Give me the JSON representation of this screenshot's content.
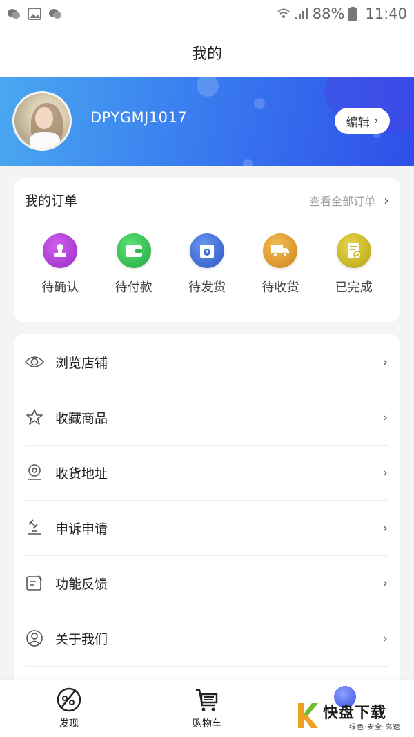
{
  "status_bar": {
    "battery_percent": "88%",
    "time": "11:40"
  },
  "header": {
    "title": "我的"
  },
  "profile": {
    "username": "DPYGMJ1017",
    "edit_label": "编辑"
  },
  "orders": {
    "title": "我的订单",
    "view_all": "查看全部订单",
    "items": [
      {
        "label": "待确认",
        "icon": "stamp-icon",
        "color": "#b23ad6"
      },
      {
        "label": "待付款",
        "icon": "wallet-icon",
        "color": "#2fbf4c"
      },
      {
        "label": "待发货",
        "icon": "package-clock-icon",
        "color": "#3b6fd8"
      },
      {
        "label": "待收货",
        "icon": "truck-icon",
        "color": "#e39a1e"
      },
      {
        "label": "已完成",
        "icon": "document-check-icon",
        "color": "#cdb81e"
      }
    ]
  },
  "menu": {
    "items": [
      {
        "label": "浏览店铺",
        "icon": "eye-icon"
      },
      {
        "label": "收藏商品",
        "icon": "star-icon"
      },
      {
        "label": "收货地址",
        "icon": "location-pin-icon"
      },
      {
        "label": "申诉申请",
        "icon": "gavel-icon"
      },
      {
        "label": "功能反馈",
        "icon": "edit-note-icon"
      },
      {
        "label": "关于我们",
        "icon": "user-circle-icon"
      }
    ]
  },
  "bottom_nav": {
    "items": [
      {
        "label": "发现",
        "icon": "compass-icon"
      },
      {
        "label": "购物车",
        "icon": "cart-icon"
      }
    ]
  },
  "watermark": {
    "main": "快盘下载",
    "sub": "绿色·安全·高速"
  }
}
